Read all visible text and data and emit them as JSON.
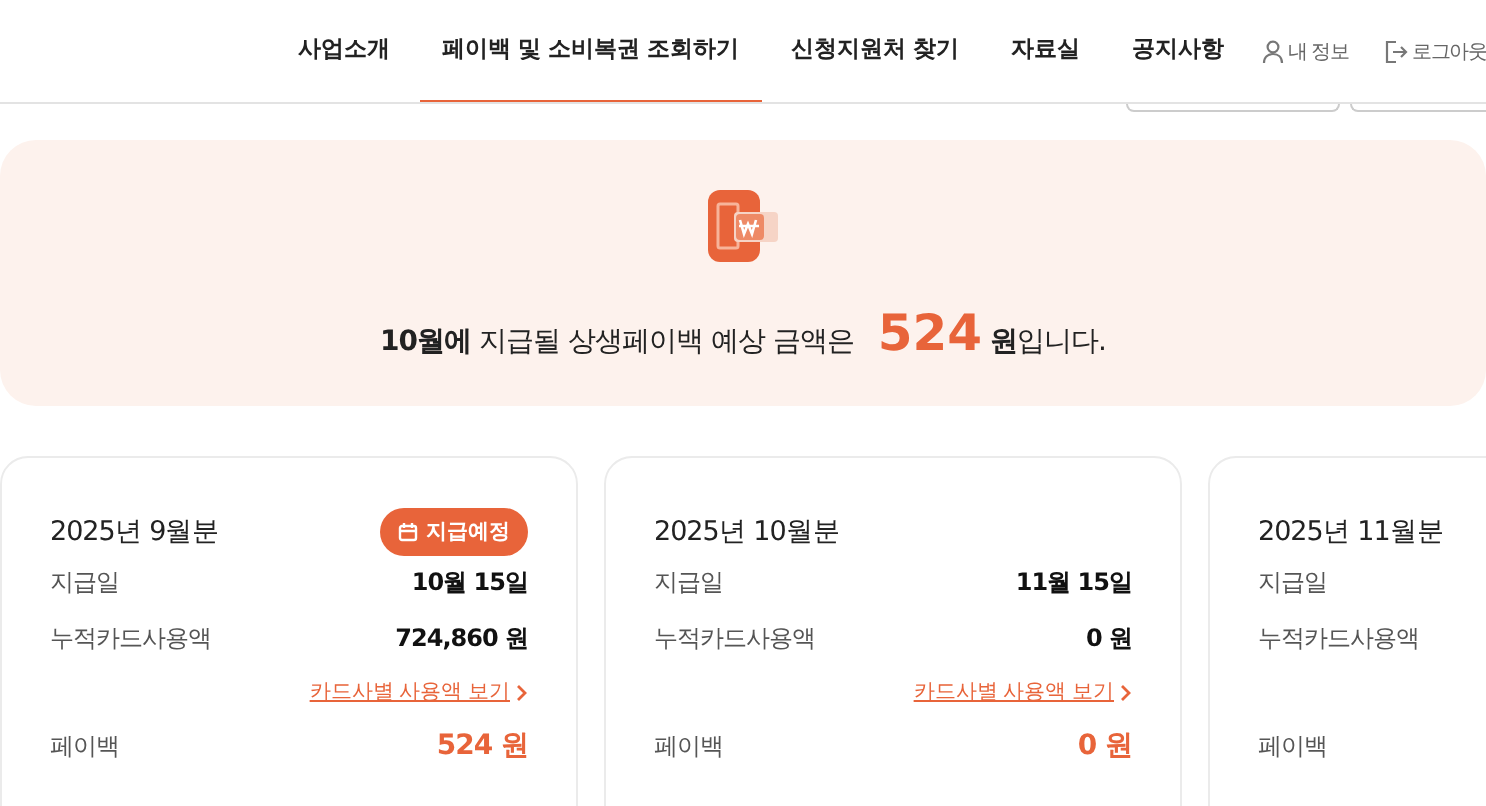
{
  "nav": {
    "items": [
      {
        "label": "사업소개",
        "selected": false
      },
      {
        "label": "페이백 및 소비복권 조회하기",
        "selected": true
      },
      {
        "label": "신청지원처 찾기",
        "selected": false
      },
      {
        "label": "자료실",
        "selected": false
      },
      {
        "label": "공지사항",
        "selected": false
      }
    ],
    "user_links": [
      {
        "kind": "profile",
        "label": "내 정보"
      },
      {
        "kind": "logout",
        "label": "로그아웃"
      }
    ]
  },
  "banner": {
    "message": "**10월에** 지급될 상생페이백 예상 금액은",
    "amount": "524",
    "unit": "**원**입니다."
  },
  "cards": [
    {
      "title": "2025년 9월분",
      "badge": "지급예정",
      "pay_date_label": "지급일",
      "pay_date": "10월 15일",
      "usage_label": "누적카드사용액",
      "usage": "724,860 원",
      "link": "카드사별 사용액 보기",
      "payback_label": "페이백",
      "payback": "524 원"
    },
    {
      "title": "2025년 10월분",
      "pay_date_label": "지급일",
      "pay_date": "11월 15일",
      "usage_label": "누적카드사용액",
      "usage": "0 원",
      "link": "카드사별 사용액 보기",
      "payback_label": "페이백",
      "payback": "0 원"
    },
    {
      "title": "2025년 11월분",
      "pay_date_label": "지급일",
      "usage_label": "누적카드사용액",
      "payback_label": "페이백"
    }
  ]
}
